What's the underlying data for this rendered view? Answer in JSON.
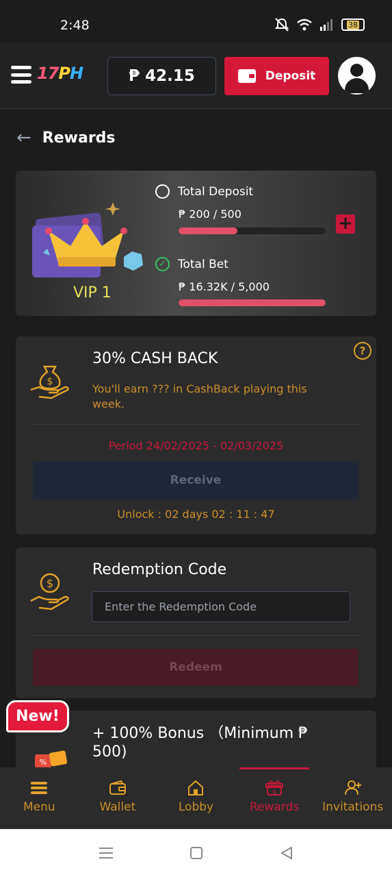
{
  "status": {
    "time": "2:48",
    "battery": "38"
  },
  "header": {
    "logo": {
      "a": "17",
      "b": "P",
      "c": "H"
    },
    "balance": "₱ 42.15",
    "deposit_label": "Deposit"
  },
  "page": {
    "title": "Rewards"
  },
  "vip": {
    "level": "VIP 1",
    "total_deposit": {
      "label": "Total Deposit",
      "value": "₱ 200 / 500",
      "progress": 0.4
    },
    "total_bet": {
      "label": "Total Bet",
      "value": "₱ 16.32K / 5,000",
      "progress": 1.0
    }
  },
  "cashback": {
    "title": "30% CASH BACK",
    "description": "You'll earn ??? in CashBack playing this week.",
    "period": "Period 24/02/2025 - 02/03/2025",
    "receive_label": "Receive",
    "unlock": "Unlock : 02 days 02 : 11 : 47"
  },
  "redemption": {
    "title": "Redemption Code",
    "placeholder": "Enter the Redemption Code",
    "redeem_label": "Redeem"
  },
  "bonus": {
    "badge": "New!",
    "title": "+ 100% Bonus （Minimum ₱ 500)"
  },
  "tabs": [
    {
      "label": "Menu",
      "icon": "menu-icon"
    },
    {
      "label": "Wallet",
      "icon": "wallet-icon"
    },
    {
      "label": "Lobby",
      "icon": "home-icon"
    },
    {
      "label": "Rewards",
      "icon": "gift-icon",
      "active": true
    },
    {
      "label": "Invitations",
      "icon": "add-user-icon"
    }
  ],
  "colors": {
    "accent": "#d4183a",
    "gold": "#c98f2a",
    "vip": "#e6e05a"
  }
}
